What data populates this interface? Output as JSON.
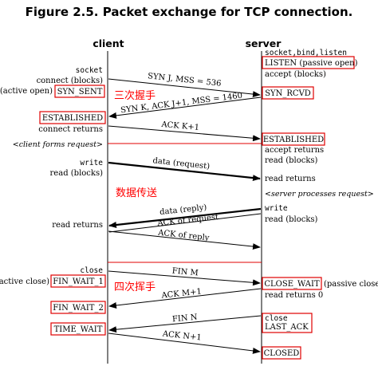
{
  "title": "Figure 2.5. Packet exchange for TCP connection.",
  "headers": {
    "client": "client",
    "server": "server"
  },
  "client_labels": {
    "socket": "socket",
    "connect": "connect (blocks)",
    "active_open": "(active open)",
    "syn_sent": "SYN_SENT",
    "established": "ESTABLISHED",
    "connect_returns": "connect returns",
    "client_forms": "<client forms request>",
    "write": "write",
    "read_blocks": "read (blocks)",
    "read_returns": "read returns",
    "close": "close",
    "active_close": "(active close)",
    "fin_wait_1": "FIN_WAIT_1",
    "fin_wait_2": "FIN_WAIT_2",
    "time_wait": "TIME_WAIT"
  },
  "server_labels": {
    "socket_bind_listen": "socket,bind,listen",
    "listen": "LISTEN",
    "passive_open": "(passive open)",
    "accept_blocks": "accept (blocks)",
    "syn_rcvd": "SYN_RCVD",
    "established": "ESTABLISHED",
    "accept_returns": "accept returns",
    "read_blocks": "read (blocks)",
    "read_returns": "read returns",
    "server_processes": "<server processes request>",
    "write": "write",
    "read_blocks2": "read (blocks)",
    "close_wait": "CLOSE_WAIT",
    "passive_close": "(passive close)",
    "read_returns_0": "read returns 0",
    "close": "close",
    "last_ack": "LAST_ACK",
    "closed": "CLOSED"
  },
  "messages": {
    "syn_j": "SYN J, MSS = 536",
    "syn_k": "SYN K, ACK J+1, MSS = 1460",
    "ack_k": "ACK K+1",
    "data_request": "data (request)",
    "data_reply": "data (reply)",
    "ack_of_request": "ACK of request",
    "ack_of_reply": "ACK of reply",
    "fin_m": "FIN M",
    "ack_m": "ACK M+1",
    "fin_n": "FIN N",
    "ack_n": "ACK N+1"
  },
  "annotations": {
    "three_way": "三次握手",
    "data_transfer": "数据传送",
    "four_way": "四次挥手"
  },
  "colors": {
    "highlight": "#e00000",
    "annotation": "#ff0000",
    "line": "#000000"
  }
}
